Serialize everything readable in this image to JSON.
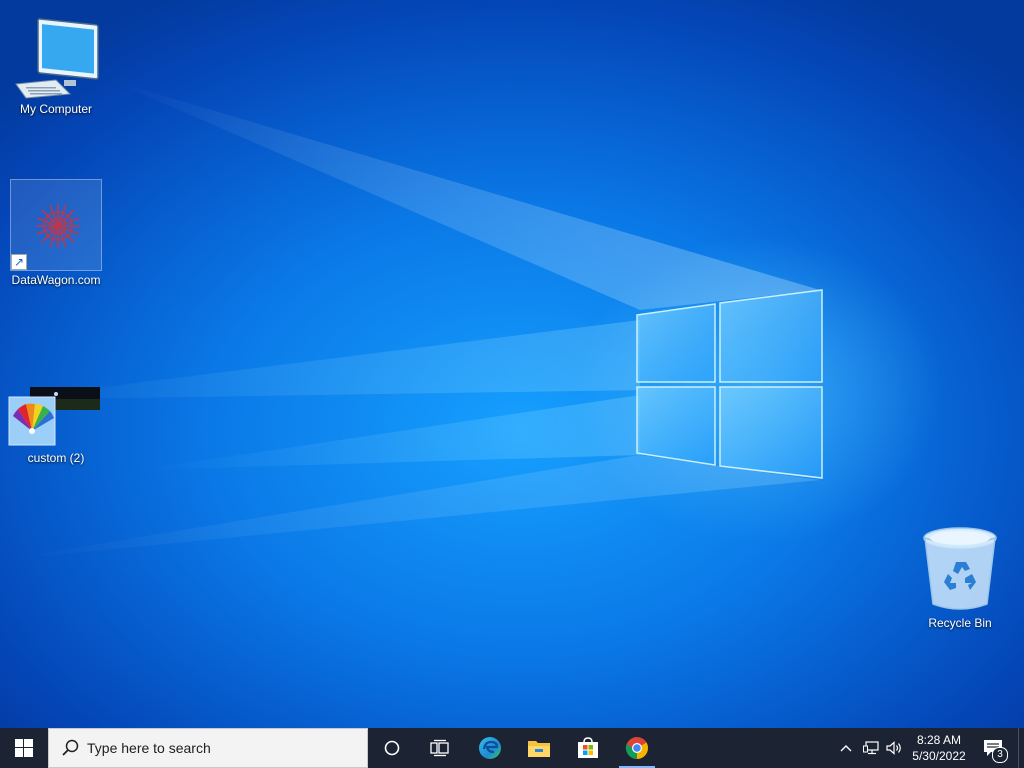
{
  "desktop": {
    "icons": [
      {
        "label": "My Computer",
        "icon": "computer-monitor-icon"
      },
      {
        "label": "DataWagon.com",
        "icon": "datawagon-shortcut-icon"
      },
      {
        "label": "custom (2)",
        "icon": "color-palette-icon"
      },
      {
        "label": "Recycle Bin",
        "icon": "recycle-bin-icon"
      }
    ]
  },
  "taskbar": {
    "search_placeholder": "Type here to search",
    "pinned": [
      {
        "name": "Cortana",
        "icon": "cortana-circle-icon"
      },
      {
        "name": "Task View",
        "icon": "task-view-icon"
      },
      {
        "name": "Microsoft Edge",
        "icon": "edge-icon"
      },
      {
        "name": "File Explorer",
        "icon": "folder-icon"
      },
      {
        "name": "Microsoft Store",
        "icon": "store-bag-icon"
      },
      {
        "name": "Google Chrome",
        "icon": "chrome-icon",
        "running": true
      }
    ],
    "tray": {
      "time": "8:28 AM",
      "date": "5/30/2022",
      "notification_count": "3"
    }
  },
  "colors": {
    "taskbar_bg": "#1c2333",
    "desktop_accent": "#0a78e6"
  }
}
